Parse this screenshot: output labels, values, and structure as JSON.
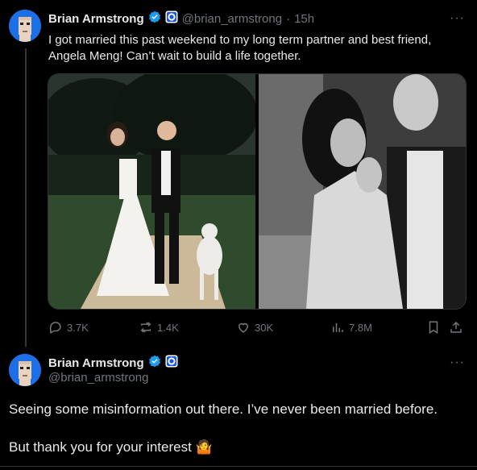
{
  "tweet1": {
    "author_name": "Brian Armstrong",
    "author_handle": "@brian_armstrong",
    "separator": "·",
    "time": "15h",
    "more_label": "···",
    "text_line1": "I got married this past weekend to my long term partner and best friend,",
    "text_line2": "Angela Meng! Can’t wait to build a life together.",
    "stats": {
      "replies": "3.7K",
      "reposts": "1.4K",
      "likes": "30K",
      "views": "7.8M"
    }
  },
  "tweet2": {
    "author_name": "Brian Armstrong",
    "author_handle": "@brian_armstrong",
    "more_label": "···",
    "text_line1": "Seeing some misinformation out there. I’ve never been married before.",
    "text_line2": "But thank you for your interest",
    "emoji": "🤷"
  },
  "colors": {
    "background": "#000000",
    "text": "#e7e9ea",
    "muted": "#71767b",
    "verified": "#1d9bf0",
    "avatar": "#1d6fe8"
  },
  "icons": [
    "verified-badge-icon",
    "affiliate-badge-icon",
    "more-icon",
    "reply-icon",
    "repost-icon",
    "like-icon",
    "views-icon",
    "bookmark-icon",
    "share-icon"
  ]
}
